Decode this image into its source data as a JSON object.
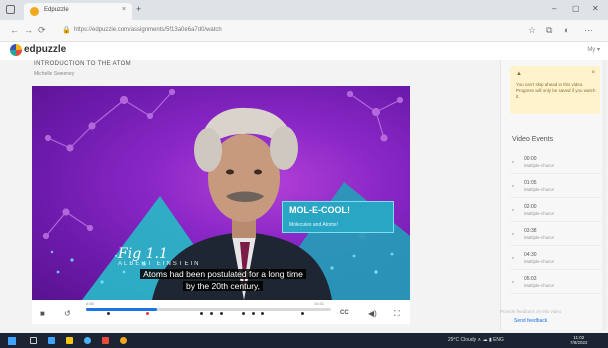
{
  "browser": {
    "tab_title": "Edpuzzle",
    "tab_close": "×",
    "new_tab": "+",
    "url": "https://edpuzzle.com/assignments/5f13a0e6a7d0/watch",
    "controls": {
      "back": "←",
      "forward": "→",
      "refresh": "⟳",
      "minimize": "–",
      "maximize": "▢",
      "close": "✕"
    },
    "toolbar_icons": [
      "star-icon",
      "collections-icon",
      "profile-icon",
      "more-icon"
    ]
  },
  "site": {
    "logo_text": "edpuzzle",
    "header_right": "My ▾"
  },
  "lesson": {
    "title": "INTRODUCTION TO THE ATOM",
    "author": "Michelle Sweeney"
  },
  "video": {
    "overlay_title": "MOL-E-COOL!",
    "overlay_sub": "Molecules and Atoms!",
    "fig_label": "Fig 1.1",
    "fig_under": "ALBERT EINSTEIN",
    "caption_line1": "Atoms had been postulated for a long time",
    "caption_line2": "by the 20th century,"
  },
  "player": {
    "time_elapsed": "0:58",
    "time_total": "10:31",
    "progress": 0.29,
    "play_icon": "■",
    "rewind_icon": "↺",
    "cc_label": "CC",
    "volume_icon": "◀)",
    "fullscreen_icon": "⛶",
    "markers": [
      0.09,
      0.25,
      0.47,
      0.51,
      0.55,
      0.64,
      0.68,
      0.72,
      0.88
    ],
    "marker_red_index": 1
  },
  "panel": {
    "notice_icon": "▲",
    "notice_close": "×",
    "notice_text": "You can't skip ahead in this video. Progress will only be saved if you watch it.",
    "ve_title": "Video Events",
    "events": [
      {
        "time": "00:00",
        "type": "Multiple-choice"
      },
      {
        "time": "01:05",
        "type": "Multiple-choice"
      },
      {
        "time": "02:00",
        "type": "Multiple-choice"
      },
      {
        "time": "03:38",
        "type": "Multiple-choice"
      },
      {
        "time": "04:30",
        "type": "Multiple-choice"
      },
      {
        "time": "05:03",
        "type": "Multiple-choice"
      }
    ],
    "feedback_text": "Provide feedback on this video",
    "feedback_link": "Send feedback"
  },
  "taskbar": {
    "tray_text": "29°C Cloudy ∧ ☁ ▮ ENG",
    "time": "11:02",
    "date": "7/8/2022"
  },
  "colors": {
    "video_bg": "#8a27c7",
    "teal": "#28a6c4",
    "accent": "#1a73e8",
    "notice": "#fff3cd",
    "taskbar": "#1c2433"
  }
}
